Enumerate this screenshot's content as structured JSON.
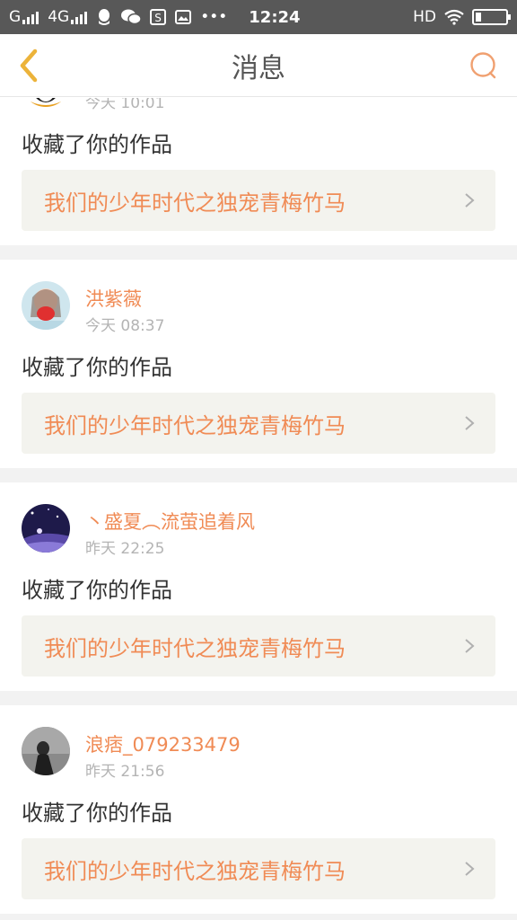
{
  "status_bar": {
    "carrier_1": "G",
    "carrier_2": "4G",
    "more": "•••",
    "time": "12:24",
    "hd": "HD",
    "icons": [
      "signal-icon",
      "qq-icon",
      "wechat-icon",
      "s-app-icon",
      "gallery-icon",
      "wifi-icon",
      "battery-icon"
    ]
  },
  "header": {
    "title": "消息",
    "back_icon": "chevron-left-icon",
    "search_icon": "search-icon",
    "accent_color": "#f0a070"
  },
  "messages": [
    {
      "username": "",
      "time": "今天 10:01",
      "action": "收藏了你的作品",
      "work_title": "我们的少年时代之独宠青梅竹马",
      "avatar": "avatar-penguin"
    },
    {
      "username": "洪紫薇",
      "time": "今天 08:37",
      "action": "收藏了你的作品",
      "work_title": "我们的少年时代之独宠青梅竹马",
      "avatar": "avatar-girl-red"
    },
    {
      "username": "丶盛夏︵流萤追着风",
      "time": "昨天 22:25",
      "action": "收藏了你的作品",
      "work_title": "我们的少年时代之独宠青梅竹马",
      "avatar": "avatar-night-sky"
    },
    {
      "username": "浪痞_079233479",
      "time": "昨天 21:56",
      "action": "收藏了你的作品",
      "work_title": "我们的少年时代之独宠青梅竹马",
      "avatar": "avatar-grey-figure"
    }
  ],
  "colors": {
    "username": "#f08b55",
    "work_title": "#f08b55",
    "link_bg": "#f3f3ee",
    "divider_bg": "#f2f2f2",
    "status_bar_bg": "#585858"
  }
}
